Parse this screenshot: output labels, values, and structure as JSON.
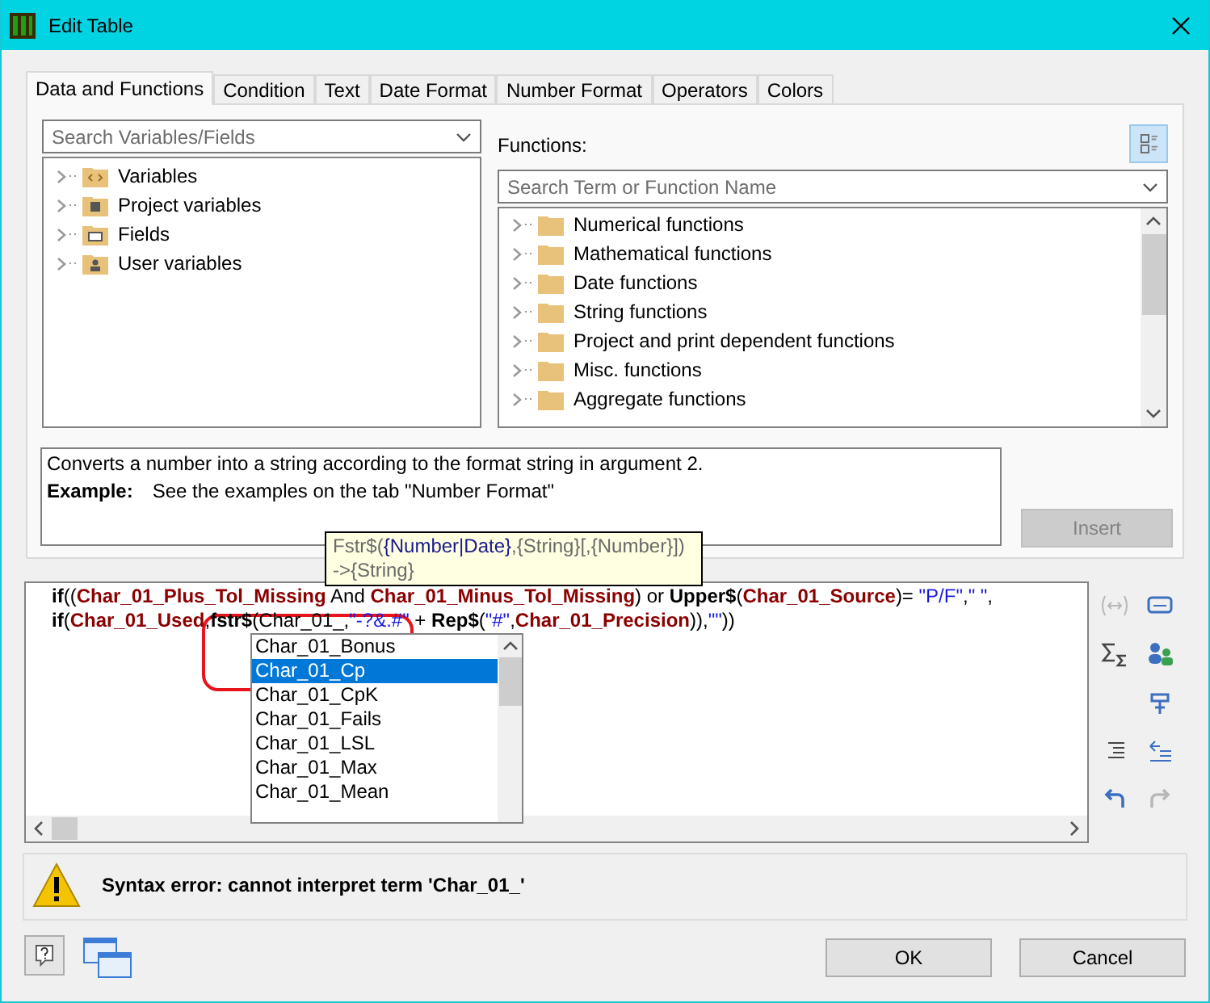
{
  "window": {
    "title": "Edit Table"
  },
  "tabs": [
    {
      "label": "Data and Functions",
      "selected": true
    },
    {
      "label": "Condition",
      "selected": false
    },
    {
      "label": "Text",
      "selected": false
    },
    {
      "label": "Date Format",
      "selected": false
    },
    {
      "label": "Number Format",
      "selected": false
    },
    {
      "label": "Operators",
      "selected": false
    },
    {
      "label": "Colors",
      "selected": false
    }
  ],
  "variables_panel": {
    "search": {
      "placeholder": "Search Variables/Fields"
    },
    "tree": [
      {
        "label": "Variables",
        "kind": "code"
      },
      {
        "label": "Project variables",
        "kind": "printer"
      },
      {
        "label": "Fields",
        "kind": "table"
      },
      {
        "label": "User variables",
        "kind": "user"
      }
    ]
  },
  "functions_panel": {
    "label": "Functions:",
    "search": {
      "placeholder": "Search Term or Function Name"
    },
    "tree": [
      {
        "label": "Numerical functions"
      },
      {
        "label": "Mathematical functions"
      },
      {
        "label": "Date functions"
      },
      {
        "label": "String functions"
      },
      {
        "label": "Project and print dependent functions"
      },
      {
        "label": "Misc. functions"
      },
      {
        "label": "Aggregate functions"
      }
    ]
  },
  "description": {
    "text": "Converts a number into a string according to the format string in argument 2.",
    "example_label": "Example:",
    "example_text": "See the examples on the tab \"Number Format\""
  },
  "insert_button": {
    "label": "Insert",
    "disabled": true
  },
  "tooltip": {
    "lines": [
      [
        {
          "text": "Fstr$(",
          "kind": "plain"
        },
        {
          "text": "{Number|Date}",
          "kind": "active"
        },
        {
          "text": ",{String}[,{Number}])",
          "kind": "plain"
        }
      ],
      [
        {
          "text": "->{String}",
          "kind": "plain"
        }
      ]
    ]
  },
  "editor": {
    "lines": [
      [
        {
          "text": "if",
          "kind": "keyword"
        },
        {
          "text": "((",
          "kind": "plain"
        },
        {
          "text": "Char_01_Plus_Tol_Missing",
          "kind": "field"
        },
        {
          "text": " And ",
          "kind": "plain"
        },
        {
          "text": "Char_01_Minus_Tol_Missing",
          "kind": "field"
        },
        {
          "text": ") or ",
          "kind": "plain"
        },
        {
          "text": "Upper$",
          "kind": "keyword"
        },
        {
          "text": "(",
          "kind": "plain"
        },
        {
          "text": "Char_01_Source",
          "kind": "field"
        },
        {
          "text": ")= ",
          "kind": "plain"
        },
        {
          "text": "\"P/F\"",
          "kind": "string"
        },
        {
          "text": ",",
          "kind": "plain"
        },
        {
          "text": "\" \"",
          "kind": "string"
        },
        {
          "text": ",",
          "kind": "plain"
        }
      ],
      [
        {
          "text": "if",
          "kind": "keyword"
        },
        {
          "text": "(",
          "kind": "plain"
        },
        {
          "text": "Char_01_Used",
          "kind": "field"
        },
        {
          "text": ",",
          "kind": "plain"
        },
        {
          "text": "fstr$",
          "kind": "keyword"
        },
        {
          "text": "(Char_01_",
          "kind": "plain"
        },
        {
          "text": ",",
          "kind": "plain"
        },
        {
          "text": "\"-?&.#\"",
          "kind": "string"
        },
        {
          "text": " + ",
          "kind": "plain"
        },
        {
          "text": "Rep$",
          "kind": "keyword"
        },
        {
          "text": "(",
          "kind": "plain"
        },
        {
          "text": "\"#\"",
          "kind": "string"
        },
        {
          "text": ",",
          "kind": "plain"
        },
        {
          "text": "Char_01_Precision",
          "kind": "field"
        },
        {
          "text": ")),",
          "kind": "plain"
        },
        {
          "text": "\"\"",
          "kind": "string"
        },
        {
          "text": "))",
          "kind": "plain"
        }
      ]
    ],
    "autocomplete": [
      {
        "label": "Char_01_Bonus",
        "selected": false
      },
      {
        "label": "Char_01_Cp",
        "selected": true
      },
      {
        "label": "Char_01_CpK",
        "selected": false
      },
      {
        "label": "Char_01_Fails",
        "selected": false
      },
      {
        "label": "Char_01_LSL",
        "selected": false
      },
      {
        "label": "Char_01_Max",
        "selected": false
      },
      {
        "label": "Char_01_Mean",
        "selected": false
      }
    ]
  },
  "editor_tools": [
    [
      {
        "kind": "wrap",
        "disabled": true
      },
      {
        "kind": "field",
        "disabled": false
      }
    ],
    [
      {
        "kind": "sum",
        "disabled": false
      },
      {
        "kind": "users",
        "disabled": false
      }
    ],
    [
      {
        "kind": "format",
        "disabled": false
      }
    ],
    [
      {
        "kind": "indent",
        "disabled": false
      },
      {
        "kind": "outdent",
        "disabled": false
      }
    ],
    [
      {
        "kind": "undo",
        "disabled": false
      },
      {
        "kind": "redo",
        "disabled": true
      }
    ]
  ],
  "error": {
    "message": "Syntax error: cannot interpret term 'Char_01_'"
  },
  "buttons": [
    {
      "label": "OK"
    },
    {
      "label": "Cancel"
    }
  ]
}
